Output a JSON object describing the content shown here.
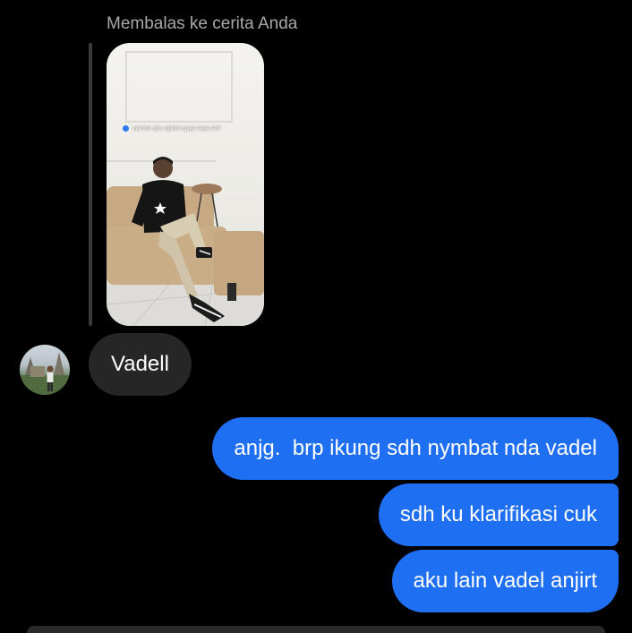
{
  "reply": {
    "label": "Membalas ke cerita Anda"
  },
  "story": {
    "caption": "nyender gitu ngikutin gaya siapa sih?"
  },
  "messages": {
    "incoming": [
      {
        "text": "Vadell"
      }
    ],
    "outgoing": [
      {
        "text": "anjg.  brp ikung sdh nymbat nda vadel"
      },
      {
        "text": "sdh ku klarifikasi cuk"
      },
      {
        "text": "aku lain vadel anjirt"
      }
    ]
  },
  "colors": {
    "background": "#000000",
    "incoming_bubble": "#262626",
    "outgoing_bubble": "#1f6ff2"
  }
}
